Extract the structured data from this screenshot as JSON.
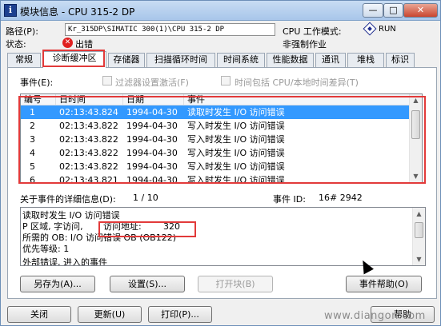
{
  "window": {
    "title": "模块信息 - CPU 315-2 DP",
    "minimize": "—",
    "maximize": "□",
    "close": "✕"
  },
  "info": {
    "path_label": "路径(P):",
    "path_value": "Kr_315DP\\SIMATIC 300(1)\\CPU 315-2 DP",
    "cpu_mode_label": "CPU 工作模式:",
    "cpu_mode_value": "RUN",
    "status_label": "状态:",
    "status_value": "出错",
    "force_value": "非强制作业"
  },
  "tabs": [
    "常规",
    "诊断缓冲区",
    "存储器",
    "扫描循环时间",
    "时间系统",
    "性能数据",
    "通讯",
    "堆栈",
    "标识"
  ],
  "events": {
    "label": "事件(E):",
    "filter_label": "过滤器设置激活(F)",
    "time_label": "时间包括 CPU/本地时间差异(T)",
    "columns": [
      "编号",
      "日时间",
      "日期",
      "事件"
    ],
    "rows": [
      {
        "no": "1",
        "time": "02:13:43.824",
        "date": "1994-04-30",
        "event": "读取时发生 I/O 访问错误"
      },
      {
        "no": "2",
        "time": "02:13:43.822",
        "date": "1994-04-30",
        "event": "写入时发生 I/O 访问错误"
      },
      {
        "no": "3",
        "time": "02:13:43.822",
        "date": "1994-04-30",
        "event": "写入时发生 I/O 访问错误"
      },
      {
        "no": "4",
        "time": "02:13:43.822",
        "date": "1994-04-30",
        "event": "写入时发生 I/O 访问错误"
      },
      {
        "no": "5",
        "time": "02:13:43.822",
        "date": "1994-04-30",
        "event": "写入时发生 I/O 访问错误"
      },
      {
        "no": "6",
        "time": "02:13:43.821",
        "date": "1994-04-30",
        "event": "写入时发生 I/O 访问错误"
      }
    ]
  },
  "details": {
    "label": "关于事件的详细信息(D):",
    "counter": "1 / 10",
    "event_id_label": "事件 ID:",
    "event_id_value": "16# 2942",
    "lines": [
      "读取时发生 I/O 访问错误",
      "P 区域, 字访问,",
      "所需的 OB: I/O 访问错误 OB (OB122)",
      "优先等级: 1",
      "外部错误, 进入的事件"
    ],
    "address_label": "访问地址:",
    "address_value": "320"
  },
  "buttons": {
    "save_as": "另存为(A)...",
    "settings": "设置(S)...",
    "open_block": "打开块(B)",
    "event_help": "事件帮助(O)",
    "close": "关闭",
    "update": "更新(U)",
    "print": "打印(P)...",
    "help": "帮助"
  },
  "watermark": "www.diangon.com"
}
